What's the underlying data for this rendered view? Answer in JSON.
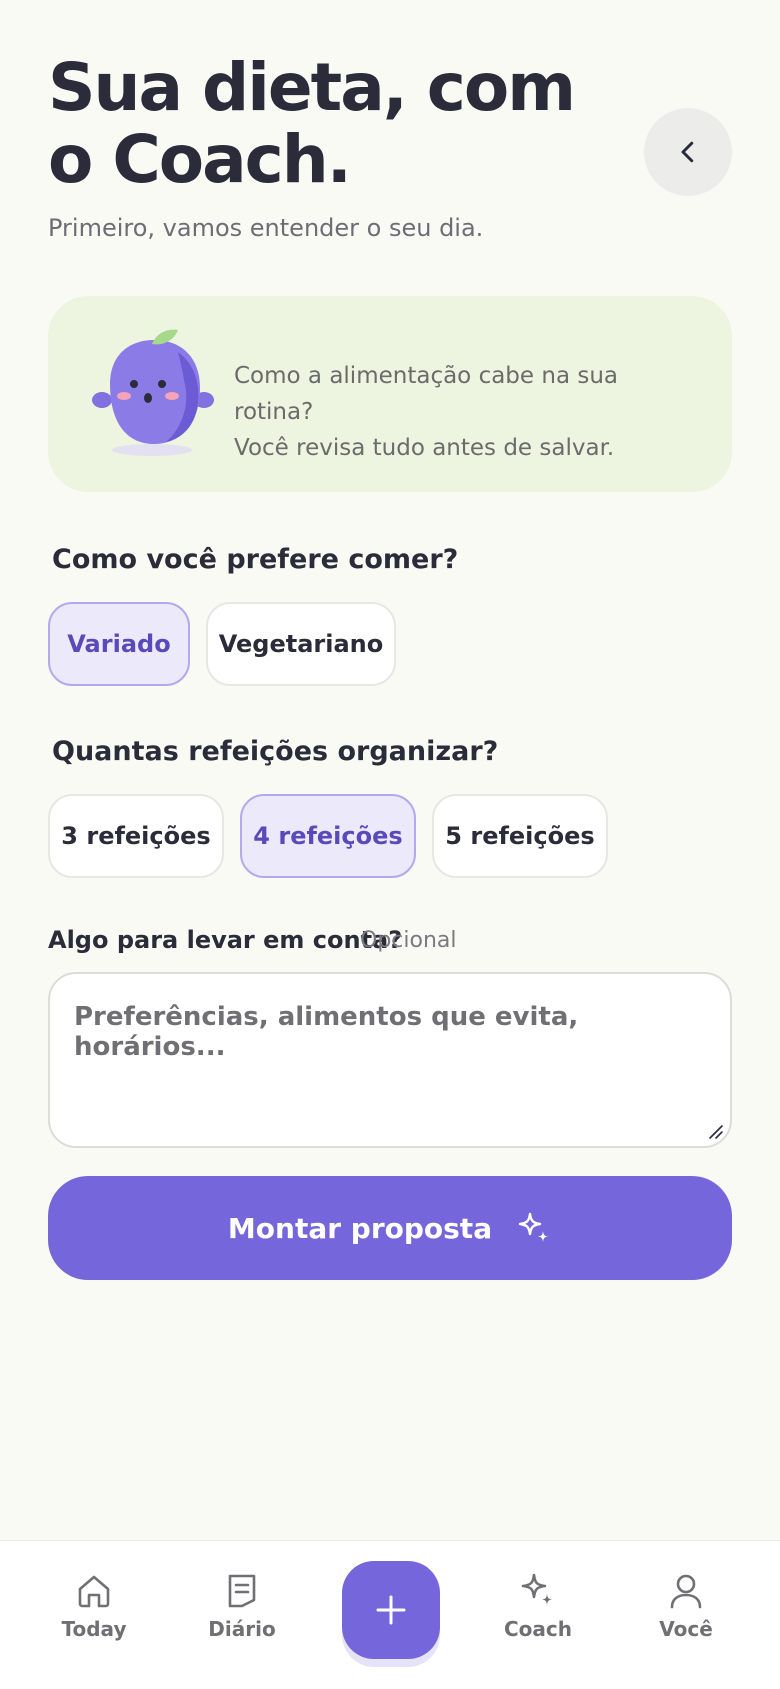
{
  "header": {
    "title": "Sua dieta, com o Coach.",
    "subtitle": "Primeiro, vamos entender o seu dia."
  },
  "intro": {
    "text_line1": "Como a alimentação cabe na sua rotina?",
    "text_line2": "Você revisa tudo antes de salvar."
  },
  "diet_question": {
    "label": "Como você prefere comer?",
    "options": [
      "Variado",
      "Vegetariano"
    ],
    "selected": "Variado"
  },
  "meals_question": {
    "label": "Quantas refeições organizar?",
    "options": [
      "3 refeições",
      "4 refeições",
      "5 refeições"
    ],
    "selected": "4 refeições"
  },
  "notes": {
    "label": "Algo para levar em conta?",
    "optional_label": "Opcional",
    "placeholder": "Preferências, alimentos que evita, horários...",
    "value": ""
  },
  "cta": {
    "label": "Montar proposta",
    "icon": "sparkle-icon"
  },
  "tabbar": {
    "items": [
      {
        "label": "Today",
        "icon": "home-icon"
      },
      {
        "label": "Diário",
        "icon": "journal-icon"
      },
      {
        "label": "",
        "icon": "plus-icon"
      },
      {
        "label": "Coach",
        "icon": "sparkle-icon"
      },
      {
        "label": "Você",
        "icon": "person-icon"
      }
    ]
  },
  "colors": {
    "accent": "#7566db",
    "background": "#fafaf5",
    "card": "#edf4df",
    "selected_chip": "#ece9fb"
  }
}
